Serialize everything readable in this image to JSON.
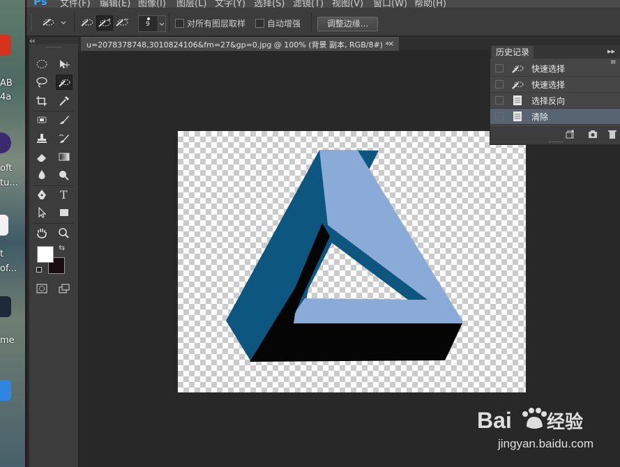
{
  "desktop": {
    "labels": [
      "AB",
      "4a",
      "oft",
      "tu...",
      "t",
      "of...",
      "me"
    ]
  },
  "menubar": {
    "logo": "Ps",
    "items": [
      "文件(F)",
      "编辑(E)",
      "图像(I)",
      "图层(L)",
      "文字(Y)",
      "选择(S)",
      "滤镜(T)",
      "视图(V)",
      "窗口(W)",
      "帮助(H)"
    ]
  },
  "options": {
    "brush_size": "9",
    "sample_all_layers": "对所有图层取样",
    "auto_enhance": "自动增强",
    "refine_edge": "调整边缘..."
  },
  "document": {
    "tab_title": "u=2078378748,3010824106&fm=27&gp=0.jpg @ 100% (背景 副本, RGB/8#) *",
    "close": "×"
  },
  "history": {
    "title": "历史记录",
    "collapse": "▸▸",
    "menu": "≡",
    "items": [
      {
        "label": "快速选择",
        "icon": "quick-selection-icon"
      },
      {
        "label": "快速选择",
        "icon": "quick-selection-icon"
      },
      {
        "label": "选择反向",
        "icon": "document-icon"
      },
      {
        "label": "清除",
        "icon": "document-icon"
      }
    ],
    "selected_index": 3
  },
  "watermark": {
    "brand_a": "Bai",
    "brand_b": "经验",
    "url": "jingyan.baidu.com"
  },
  "colors": {
    "triangle_dark": "#0d5680",
    "triangle_light": "#8aaad8",
    "triangle_shadow": "#050505",
    "selection_row": "#596473",
    "app_bg": "#282828"
  }
}
